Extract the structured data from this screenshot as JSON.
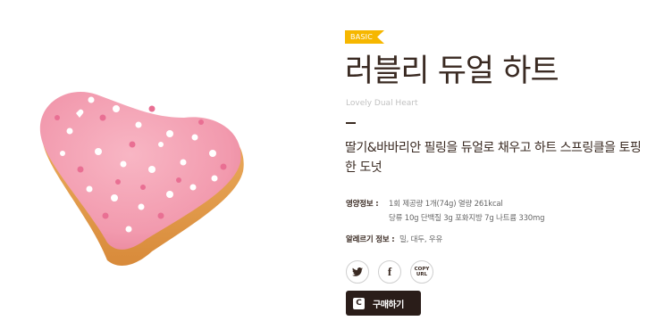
{
  "product": {
    "badge": "BASIC",
    "title": "러블리 듀얼 하트",
    "subtitle": "Lovely Dual Heart",
    "description": "딸기&바바리안 필링을 듀얼로 채우고 하트 스프링클을 토핑한 도넛",
    "image_alt": "heart-shaped pink glazed donut with heart sprinkles"
  },
  "nutrition": {
    "label": "영양정보 :",
    "line1": "1회 제공량 1개(74g) 열량 261kcal",
    "line2": "당류 10g 단백질 3g 포화지방 7g 나트륨 330mg"
  },
  "allergy": {
    "label": "알레르기 정보 :",
    "value": "밀, 대두, 우유"
  },
  "share": {
    "twitter_icon": "twitter-icon",
    "facebook_label": "f",
    "copy_line1": "COPY",
    "copy_line2": "URL"
  },
  "buy": {
    "icon_glyph": "C",
    "label": "구매하기"
  },
  "colors": {
    "badge": "#f6b700",
    "title": "#3a2a22",
    "buy_button": "#2a1d19",
    "glaze": "#f29aae"
  }
}
